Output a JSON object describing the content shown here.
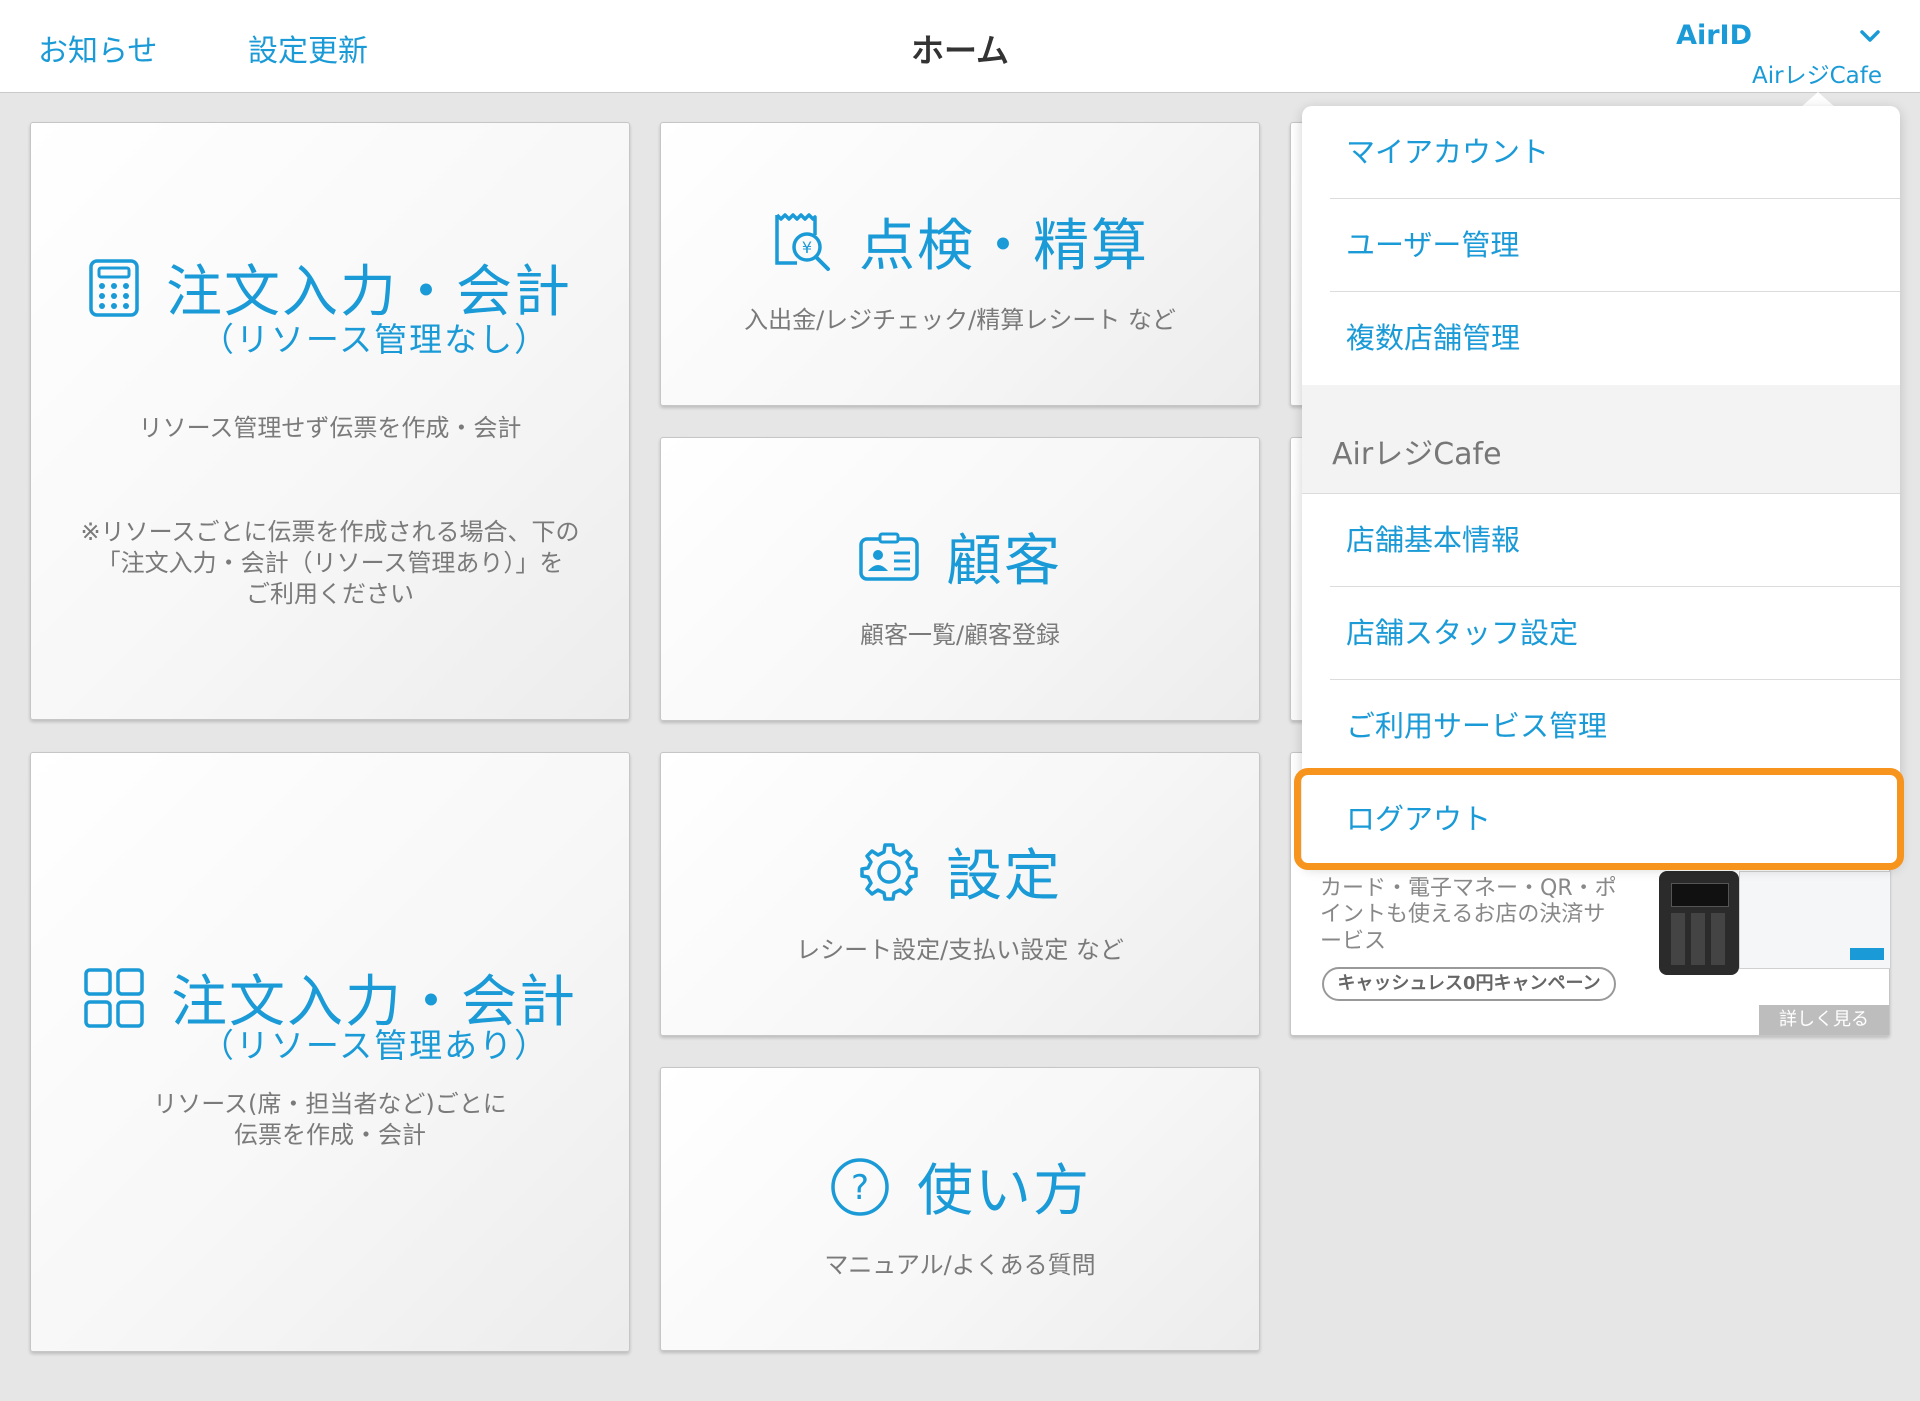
{
  "header": {
    "news": "お知らせ",
    "settings_update": "設定更新",
    "title": "ホーム",
    "account_name": "AirID",
    "store_name": "AirレジCafe"
  },
  "tiles": {
    "order_no_resource": {
      "title": "注文入力・会計",
      "subtitle": "（リソース管理なし）",
      "desc": "リソース管理せず伝票を作成・会計",
      "note_line1": "※リソースごとに伝票を作成される場合、下の",
      "note_line2": "「注文入力・会計（リソース管理あり）」を",
      "note_line3": "ご利用ください"
    },
    "order_with_resource": {
      "title": "注文入力・会計",
      "subtitle": "（リソース管理あり）",
      "desc_line1": "リソース(席・担当者など)ごとに",
      "desc_line2": "伝票を作成・会計"
    },
    "inspection": {
      "title": "点検・精算",
      "desc": "入出金/レジチェック/精算レシート など"
    },
    "customer": {
      "title": "顧客",
      "desc": "顧客一覧/顧客登録"
    },
    "settings": {
      "title": "設定",
      "desc": "レシート設定/支払い設定 など"
    },
    "howto": {
      "title": "使い方",
      "desc": "マニュアル/よくある質問"
    }
  },
  "menu": {
    "my_account": "マイアカウント",
    "user_management": "ユーザー管理",
    "multi_store": "複数店舗管理",
    "store_section": "AirレジCafe",
    "store_info": "店舗基本情報",
    "staff_settings": "店舗スタッフ設定",
    "service_management": "ご利用サービス管理",
    "logout": "ログアウト"
  },
  "promo": {
    "text": "カード・電子マネー・QR・ポイントも使えるお店の決済サービス",
    "campaign": "キャッシュレス0円キャンペーン",
    "more": "詳しく見る"
  },
  "colors": {
    "accent": "#1a9ad6",
    "highlight": "#f7941d"
  }
}
